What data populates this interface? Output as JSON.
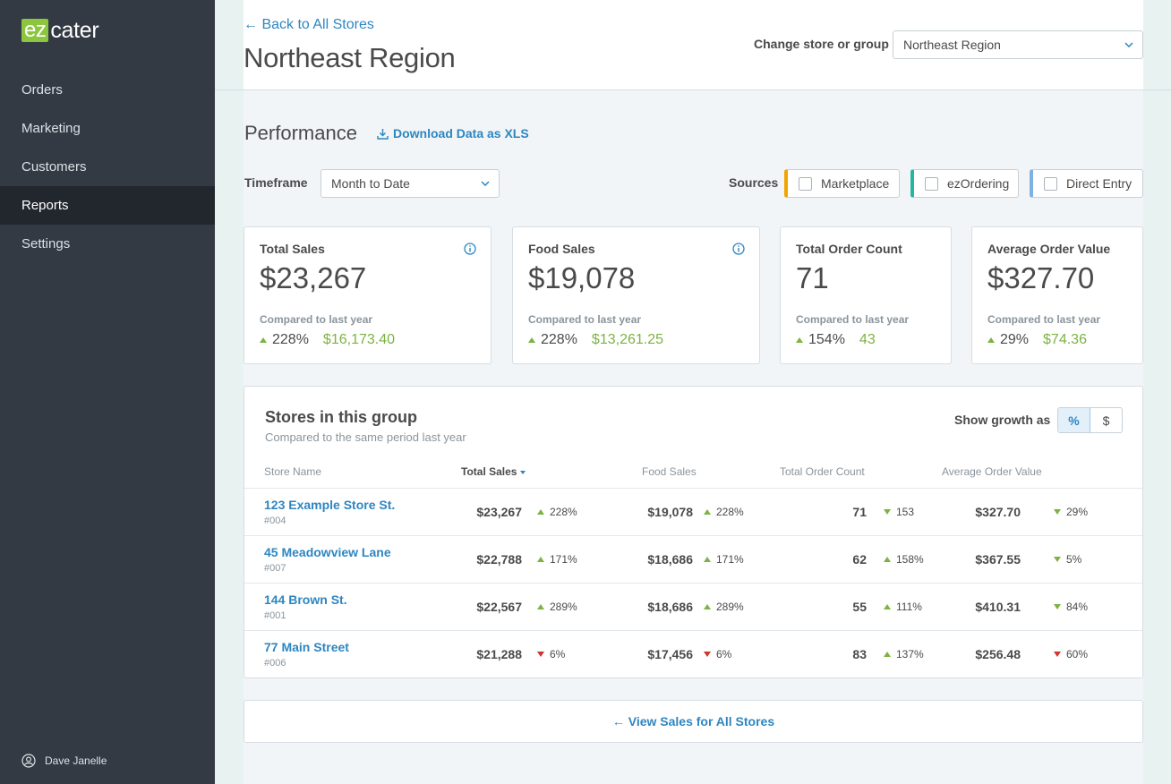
{
  "sidebar": {
    "logo_left": "ez",
    "logo_right": "cater",
    "items": [
      {
        "label": "Orders"
      },
      {
        "label": "Marketing"
      },
      {
        "label": "Customers"
      },
      {
        "label": "Reports"
      },
      {
        "label": "Settings"
      }
    ],
    "active": "Reports",
    "user": "Dave Janelle"
  },
  "header": {
    "back_link": "← Back to All Stores",
    "title": "Northeast Region",
    "change_label": "Change store or group",
    "store_select_value": "Northeast Region"
  },
  "performance": {
    "title": "Performance",
    "download_label": "Download Data as XLS",
    "timeframe_label": "Timeframe",
    "timeframe_value": "Month to Date",
    "sources_label": "Sources",
    "sources": [
      {
        "label": "Marketplace",
        "color": "#f0a500"
      },
      {
        "label": "ezOrdering",
        "color": "#26b5a3"
      },
      {
        "label": "Direct Entry",
        "color": "#7fb2e0"
      }
    ]
  },
  "kpis": [
    {
      "title": "Total Sales",
      "value": "$23,267",
      "compare": "Compared to last year",
      "growth": "228%",
      "delta": "$16,173.40",
      "info": true
    },
    {
      "title": "Food Sales",
      "value": "$19,078",
      "compare": "Compared to last year",
      "growth": "228%",
      "delta": "$13,261.25",
      "info": true
    },
    {
      "title": "Total Order Count",
      "value": "71",
      "compare": "Compared to last year",
      "growth": "154%",
      "delta": "43",
      "info": false
    },
    {
      "title": "Average Order Value",
      "value": "$327.70",
      "compare": "Compared to last year",
      "growth": "29%",
      "delta": "$74.36",
      "info": false
    }
  ],
  "stores": {
    "title": "Stores in this group",
    "subtitle": "Compared to the same period last year",
    "growth_label": "Show growth as",
    "toggle": [
      "%",
      "$"
    ],
    "columns": [
      "Store Name",
      "Total Sales",
      "Food Sales",
      "Total Order Count",
      "Average Order Value"
    ],
    "rows": [
      {
        "name": "123 Example Store St.",
        "id": "#004",
        "total": "$23,267",
        "total_pct": "228%",
        "total_dir": "up",
        "food": "$19,078",
        "food_pct": "228%",
        "food_dir": "up",
        "orders": "71",
        "orders_pct": "153",
        "orders_dir": "down-green",
        "aov": "$327.70",
        "aov_pct": "29%",
        "aov_dir": "down-green"
      },
      {
        "name": "45 Meadowview Lane",
        "id": "#007",
        "total": "$22,788",
        "total_pct": "171%",
        "total_dir": "up",
        "food": "$18,686",
        "food_pct": "171%",
        "food_dir": "up",
        "orders": "62",
        "orders_pct": "158%",
        "orders_dir": "up",
        "aov": "$367.55",
        "aov_pct": "5%",
        "aov_dir": "down-green"
      },
      {
        "name": "144 Brown St.",
        "id": "#001",
        "total": "$22,567",
        "total_pct": "289%",
        "total_dir": "up",
        "food": "$18,686",
        "food_pct": "289%",
        "food_dir": "up",
        "orders": "55",
        "orders_pct": "111%",
        "orders_dir": "up",
        "aov": "$410.31",
        "aov_pct": "84%",
        "aov_dir": "down-green"
      },
      {
        "name": "77 Main Street",
        "id": "#006",
        "total": "$21,288",
        "total_pct": "6%",
        "total_dir": "down",
        "food": "$17,456",
        "food_pct": "6%",
        "food_dir": "down",
        "orders": "83",
        "orders_pct": "137%",
        "orders_dir": "up",
        "aov": "$256.48",
        "aov_pct": "60%",
        "aov_dir": "down"
      }
    ]
  },
  "view_all_label": "← View Sales for All Stores",
  "colors": {
    "accent": "#2e86c1",
    "positive": "#7cb342",
    "negative": "#d0342c",
    "sidebar": "#333a44",
    "logo": "#8cc63f"
  }
}
